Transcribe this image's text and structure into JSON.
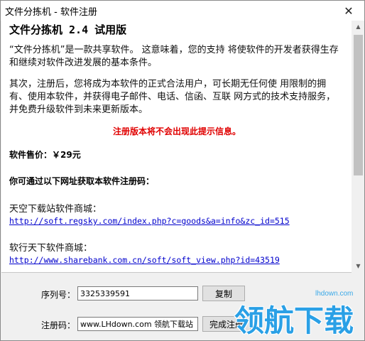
{
  "window": {
    "title": "文件分拣机 - 软件注册",
    "close_glyph": "✕"
  },
  "content": {
    "heading": "文件分拣机 2.4 试用版",
    "para1": "“文件分拣机”是一款共享软件。 这意味着，您的支持 将使软件的开发者获得生存和继续对软件改进发展的基本条件。",
    "para2": "其次，注册后，您将成为本软件的正式合法用户，可长期无任何使 用限制的拥有、使用本软件，并获得电子邮件、电话、信函、互联 网方式的技术支持服务，并免费升级软件到未来更新版本。",
    "notice": "注册版本将不会出现此提示信息。",
    "price": "软件售价：￥29元",
    "how_to": "你可通过以下网址获取本软件注册码：",
    "sites": [
      {
        "label": "天空下载站软件商城：",
        "url": "http://soft.regsky.com/index.php?c=goods&a=info&zc_id=515"
      },
      {
        "label": "软行天下软件商城：",
        "url": "http://www.sharebank.com.cn/soft/soft_view.php?id=43519"
      }
    ]
  },
  "scrollbar": {
    "up_glyph": "▲",
    "down_glyph": "▼"
  },
  "form": {
    "serial_label": "序列号：",
    "serial_value": "3325339591",
    "copy_button": "复制",
    "code_label": "注册码：",
    "code_value": "www.LHdown.com 领航下载站",
    "finish_button": "完成注册"
  },
  "watermark": {
    "url": "lhdown.com",
    "text": "领航下载"
  },
  "colors": {
    "notice": "#e00000",
    "link": "#0000cc",
    "watermark": "#2aa0e6"
  }
}
